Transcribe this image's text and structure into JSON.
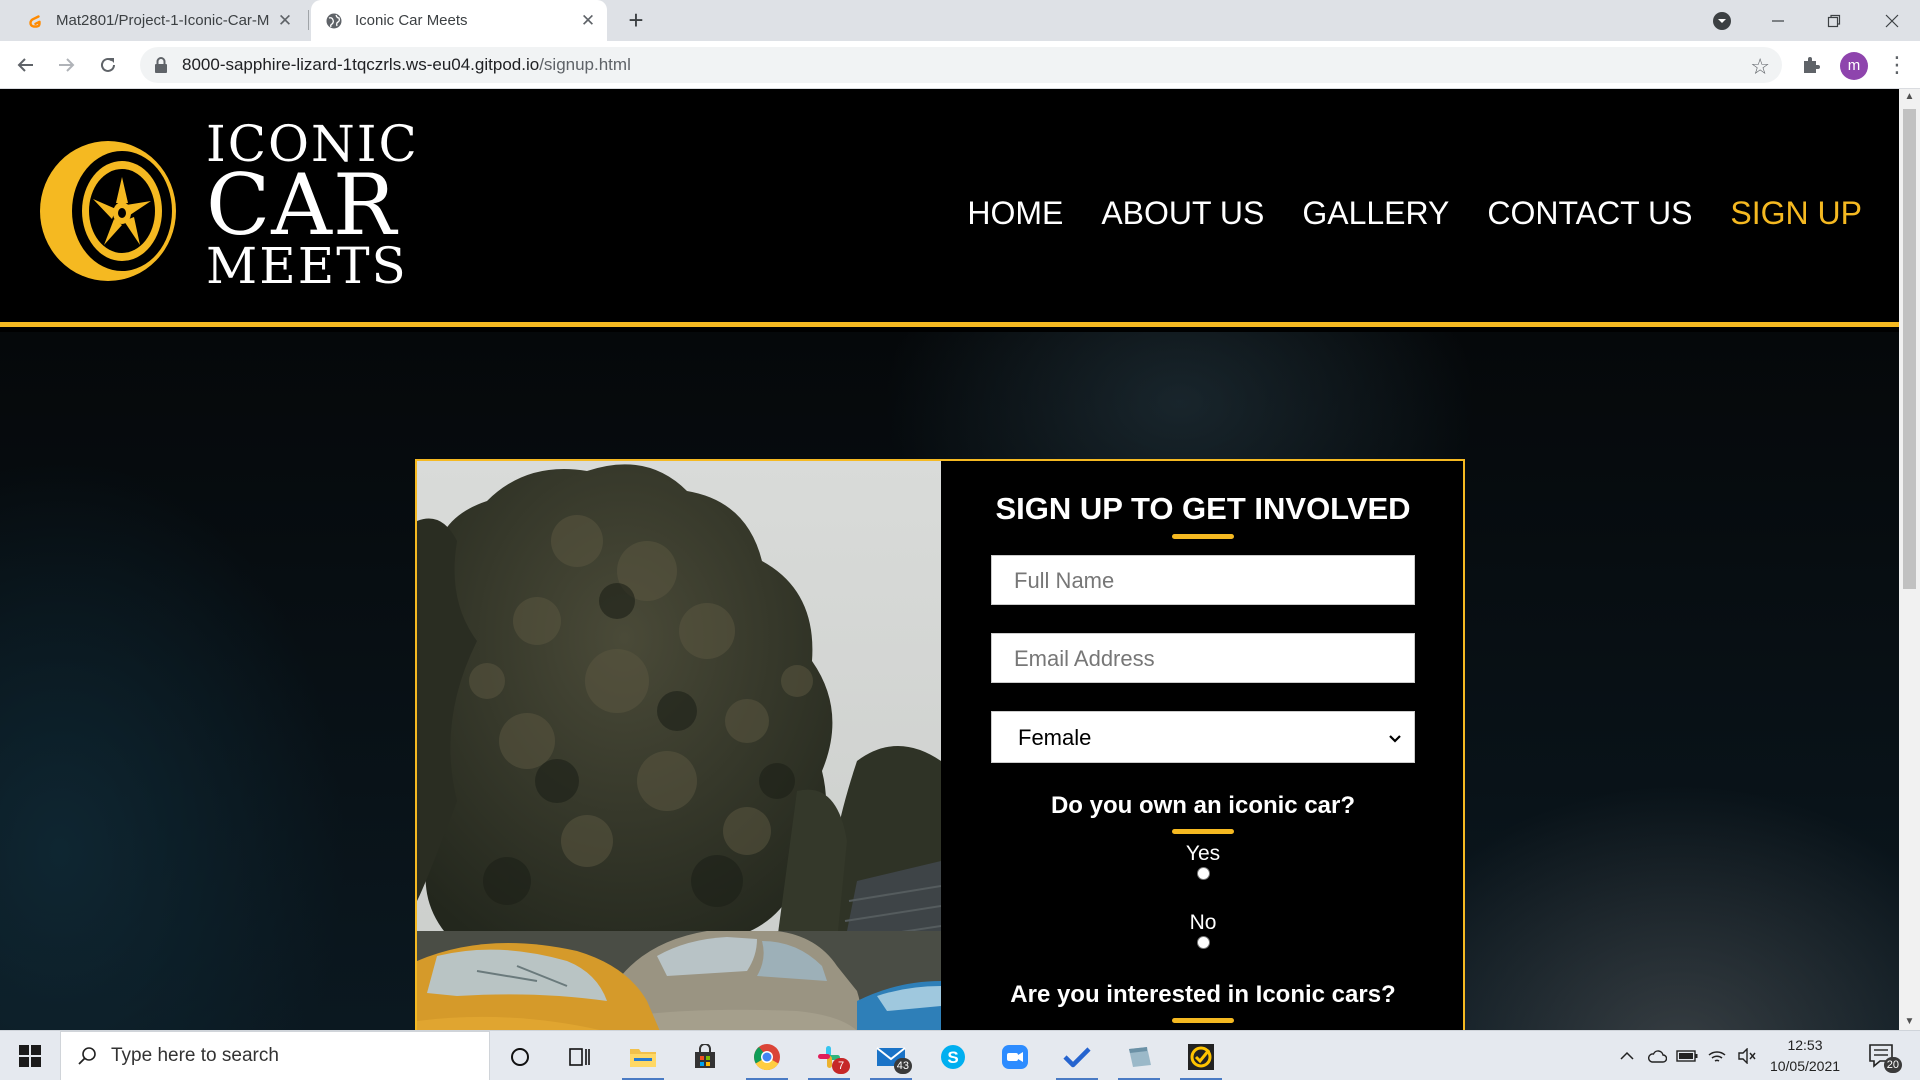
{
  "browser": {
    "tabs": [
      {
        "label": "Mat2801/Project-1-Iconic-Car-M",
        "active": false,
        "favicon": "gitpod-favicon-icon"
      },
      {
        "label": "Iconic Car Meets",
        "active": true,
        "favicon": "globe-icon"
      }
    ],
    "url": {
      "host": "8000-sapphire-lizard-1tqczrls.ws-eu04.gitpod.io",
      "path": "/signup.html"
    },
    "profile_initial": "m"
  },
  "site": {
    "logo": {
      "line1": "ICONIC",
      "line2": "CAR",
      "line3": "MEETS"
    },
    "nav": [
      {
        "label": "HOME",
        "active": false
      },
      {
        "label": "ABOUT US",
        "active": false
      },
      {
        "label": "GALLERY",
        "active": false
      },
      {
        "label": "CONTACT US",
        "active": false
      },
      {
        "label": "SIGN UP",
        "active": true
      }
    ],
    "accent_color": "#f5b921"
  },
  "signup_form": {
    "title": "SIGN UP TO GET INVOLVED",
    "full_name_placeholder": "Full Name",
    "email_placeholder": "Email Address",
    "gender_selected": "Female",
    "question_own": "Do you own an iconic car?",
    "option_yes": "Yes",
    "option_no": "No",
    "question_interested": "Are you interested in Iconic cars?"
  },
  "taskbar": {
    "search_placeholder": "Type here to search",
    "slack_badge": "7",
    "mail_badge": "43",
    "clock_time": "12:53",
    "clock_date": "10/05/2021",
    "notification_count": "20"
  }
}
